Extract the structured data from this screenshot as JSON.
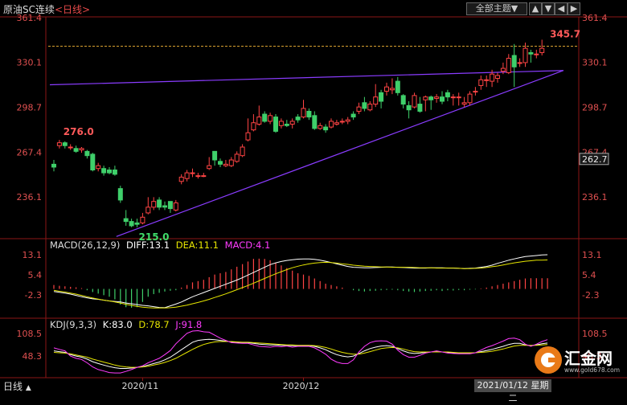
{
  "header": {
    "title": "原油SC连续",
    "period": "<日线>",
    "theme_label": "全部主题▼",
    "theme_arrow": "▼",
    "nav_up": "▲",
    "nav_down": "▼",
    "nav_prev": "◀",
    "nav_next": "▶"
  },
  "footer": {
    "period_label": "日线",
    "period_arrow": "▲",
    "date_readout": "2021/01/12 星期二"
  },
  "macd": {
    "title": "MACD(26,12,9)",
    "diff_label": "DIFF:13.1",
    "dea_label": "DEA:11.1",
    "macd_label": "MACD:4.1",
    "ticks": [
      13.1,
      5.4,
      -2.3
    ],
    "range": [
      -7.2,
      17.4
    ],
    "colors": {
      "diff": "#ffffff",
      "dea": "#e6e600",
      "macd": "#ff00ff"
    }
  },
  "kdj": {
    "title": "KDJ(9,3,3)",
    "k_label": "K:83.0",
    "d_label": "D:78.7",
    "j_label": "J:91.8",
    "ticks": [
      108.5,
      48.3
    ],
    "range": [
      -15,
      125
    ],
    "colors": {
      "k": "#ffffff",
      "d": "#e6e600",
      "j": "#ff00ff"
    }
  },
  "logo": {
    "text": "汇金网",
    "url": "www.gold678.com"
  },
  "chart_data": {
    "type": "candlestick",
    "title": "原油SC连续",
    "y_ticks": [
      361.4,
      330.1,
      298.7,
      267.4,
      236.1
    ],
    "ylim": [
      207,
      362
    ],
    "x_tick_labels": [
      {
        "label": "2020/11",
        "index": 16
      },
      {
        "label": "2020/12",
        "index": 45
      }
    ],
    "last_price": 262.7,
    "high_annotation": {
      "label": "345.7",
      "index": 89
    },
    "prior_high_annotation": {
      "label": "276.0",
      "index": 2
    },
    "low_annotation": {
      "label": "215.0",
      "index": 15
    },
    "dashed_reference": 341.5,
    "trendlines": [
      {
        "from": {
          "index": 0,
          "value": 314.5
        },
        "to": {
          "index": 91,
          "value": 324.5
        }
      },
      {
        "from": {
          "index": 12,
          "value": 208.5
        },
        "to": {
          "index": 91,
          "value": 324.5
        }
      }
    ],
    "candles": [
      [
        259,
        257,
        262,
        254
      ],
      [
        272,
        274,
        276,
        270
      ],
      [
        274,
        272,
        275,
        270
      ],
      [
        271,
        271,
        273,
        269
      ],
      [
        270,
        268,
        272,
        267
      ],
      [
        269,
        270,
        271,
        267
      ],
      [
        268,
        265,
        269,
        263
      ],
      [
        266,
        255,
        267,
        254
      ],
      [
        256,
        258,
        260,
        254
      ],
      [
        256,
        253,
        258,
        251
      ],
      [
        255,
        253,
        257,
        252
      ],
      [
        255,
        252,
        258,
        251
      ],
      [
        242,
        234,
        244,
        232
      ],
      [
        221,
        219,
        227,
        216
      ],
      [
        219,
        216,
        221,
        215
      ],
      [
        218,
        217,
        221,
        215
      ],
      [
        218,
        222,
        225,
        217
      ],
      [
        225,
        229,
        236,
        224
      ],
      [
        229,
        233,
        236,
        227
      ],
      [
        234,
        229,
        236,
        227
      ],
      [
        230,
        229,
        233,
        227
      ],
      [
        233,
        228,
        233,
        225
      ],
      [
        227,
        232,
        234,
        226
      ],
      [
        247,
        250,
        252,
        245
      ],
      [
        249,
        253,
        255,
        247
      ],
      [
        253,
        253,
        256,
        250
      ],
      [
        251,
        251,
        253,
        249
      ],
      [
        251,
        251,
        253,
        250
      ],
      [
        256,
        258,
        264,
        255
      ],
      [
        268,
        262,
        268,
        258
      ],
      [
        261,
        259,
        263,
        257
      ],
      [
        258,
        259,
        262,
        257
      ],
      [
        258,
        262,
        264,
        257
      ],
      [
        261,
        266,
        268,
        260
      ],
      [
        265,
        271,
        273,
        264
      ],
      [
        276,
        281,
        291,
        275
      ],
      [
        283,
        288,
        294,
        282
      ],
      [
        287,
        292,
        300,
        286
      ],
      [
        294,
        289,
        296,
        288
      ],
      [
        289,
        293,
        295,
        287
      ],
      [
        292,
        282,
        294,
        281
      ],
      [
        286,
        289,
        291,
        284
      ],
      [
        287,
        286,
        290,
        285
      ],
      [
        287,
        289,
        291,
        284
      ],
      [
        292,
        290,
        294,
        288
      ],
      [
        292,
        298,
        304,
        291
      ],
      [
        296,
        292,
        298,
        290
      ],
      [
        293,
        284,
        296,
        283
      ],
      [
        284,
        286,
        288,
        283
      ],
      [
        285,
        283,
        287,
        281
      ],
      [
        285,
        289,
        291,
        284
      ],
      [
        287,
        288,
        290,
        286
      ],
      [
        289,
        289,
        291,
        287
      ],
      [
        289,
        290,
        292,
        287
      ],
      [
        294,
        292,
        296,
        290
      ],
      [
        296,
        299,
        302,
        294
      ],
      [
        302,
        298,
        306,
        296
      ],
      [
        297,
        301,
        303,
        296
      ],
      [
        301,
        306,
        315,
        299
      ],
      [
        309,
        303,
        311,
        298
      ],
      [
        310,
        313,
        316,
        307
      ],
      [
        311,
        312,
        319,
        308
      ],
      [
        317,
        309,
        320,
        307
      ],
      [
        307,
        301,
        308,
        298
      ],
      [
        300,
        297,
        303,
        291
      ],
      [
        299,
        307,
        309,
        298
      ],
      [
        301,
        296,
        306,
        295
      ],
      [
        304,
        306,
        307,
        296
      ],
      [
        306,
        304,
        307,
        297
      ],
      [
        305,
        306,
        308,
        302
      ],
      [
        306,
        303,
        310,
        301
      ],
      [
        309,
        306,
        311,
        303
      ],
      [
        306,
        306,
        308,
        300
      ],
      [
        306,
        306,
        309,
        300
      ],
      [
        301,
        302,
        306,
        299
      ],
      [
        302,
        308,
        310,
        300
      ],
      [
        310,
        310,
        313,
        307
      ],
      [
        314,
        318,
        321,
        311
      ],
      [
        318,
        318,
        321,
        313
      ],
      [
        317,
        322,
        325,
        313
      ],
      [
        319,
        321,
        323,
        316
      ],
      [
        324,
        326,
        330,
        322
      ],
      [
        323,
        333,
        336,
        322
      ],
      [
        335,
        327,
        343,
        313
      ],
      [
        330,
        330,
        333,
        327
      ],
      [
        330,
        340,
        344,
        327
      ],
      [
        337,
        336,
        339,
        330
      ],
      [
        336,
        336,
        339,
        333
      ],
      [
        337,
        340,
        346,
        335
      ]
    ],
    "macd_values": [
      1.5,
      1.2,
      1.0,
      0.8,
      0.6,
      0.3,
      -0.5,
      -1.2,
      -1.8,
      -2.4,
      -3.0,
      -4.0,
      -6.0,
      -7.0,
      -7.2,
      -7.0,
      -5.0,
      -3.0,
      -2.0,
      -1.5,
      -1.0,
      -0.7,
      -0.5,
      0.5,
      1.5,
      2.5,
      3.0,
      3.5,
      4.5,
      5.5,
      6.0,
      6.5,
      7.5,
      8.5,
      9.5,
      10.5,
      11.5,
      11.6,
      11.5,
      11.0,
      10.0,
      9.0,
      8.0,
      7.0,
      6.0,
      5.5,
      5.0,
      4.0,
      3.0,
      2.0,
      1.5,
      1.0,
      0.5,
      0.0,
      -0.5,
      -0.8,
      -1.0,
      -0.8,
      -0.7,
      -0.5,
      -0.4,
      -0.3,
      -0.5,
      -0.8,
      -1.0,
      -1.2,
      -1.0,
      -0.8,
      -0.7,
      -0.5,
      -0.8,
      -0.5,
      -0.6,
      -0.4,
      -0.5,
      -0.3,
      -0.2,
      0.2,
      0.5,
      1.0,
      1.5,
      2.0,
      2.5,
      3.0,
      3.5,
      4.0,
      4.1,
      4.1,
      4.1,
      4.1
    ],
    "diff_values": [
      -1.0,
      -1.3,
      -1.6,
      -2.0,
      -2.5,
      -3.0,
      -3.4,
      -3.8,
      -4.0,
      -4.3,
      -4.6,
      -4.8,
      -5.0,
      -5.4,
      -5.7,
      -6.0,
      -6.3,
      -6.5,
      -6.8,
      -7.1,
      -7.2,
      -6.5,
      -5.8,
      -5.0,
      -4.0,
      -3.0,
      -2.2,
      -1.4,
      -0.6,
      0.2,
      1.0,
      1.8,
      2.6,
      3.4,
      4.3,
      5.3,
      6.3,
      7.3,
      8.3,
      9.3,
      10.0,
      10.5,
      10.9,
      11.2,
      11.4,
      11.5,
      11.5,
      11.3,
      11.0,
      10.6,
      10.1,
      9.6,
      9.1,
      8.6,
      8.3,
      8.2,
      8.1,
      8.1,
      8.2,
      8.3,
      8.4,
      8.4,
      8.3,
      8.2,
      8.1,
      8.0,
      8.0,
      8.0,
      8.1,
      8.1,
      8.1,
      8.0,
      8.0,
      7.9,
      7.8,
      7.9,
      8.0,
      8.3,
      8.6,
      9.1,
      9.8,
      10.4,
      11.0,
      11.5,
      12.0,
      12.4,
      12.6,
      12.8,
      13.0,
      13.1
    ],
    "dea_values": [
      -0.5,
      -0.9,
      -1.2,
      -1.6,
      -2.0,
      -2.5,
      -3.0,
      -3.5,
      -3.9,
      -4.3,
      -4.6,
      -5.0,
      -5.4,
      -5.9,
      -6.3,
      -6.7,
      -7.0,
      -7.2,
      -7.3,
      -7.3,
      -7.3,
      -7.2,
      -7.0,
      -6.6,
      -6.2,
      -5.7,
      -5.2,
      -4.6,
      -4.0,
      -3.3,
      -2.6,
      -1.9,
      -1.1,
      -0.3,
      0.5,
      1.3,
      2.2,
      3.1,
      4.0,
      4.9,
      5.8,
      6.6,
      7.4,
      8.1,
      8.7,
      9.2,
      9.6,
      9.9,
      10.1,
      10.2,
      10.1,
      9.9,
      9.6,
      9.4,
      9.1,
      8.9,
      8.7,
      8.6,
      8.5,
      8.4,
      8.4,
      8.3,
      8.3,
      8.3,
      8.3,
      8.2,
      8.1,
      8.1,
      8.1,
      8.0,
      8.0,
      8.0,
      8.0,
      7.9,
      7.8,
      7.8,
      7.9,
      8.0,
      8.2,
      8.5,
      8.8,
      9.2,
      9.6,
      10.0,
      10.3,
      10.6,
      10.8,
      11.0,
      11.0,
      11.1
    ],
    "k_values": [
      62,
      60,
      58,
      52,
      48,
      45,
      40,
      33,
      28,
      24,
      20,
      17,
      15,
      15,
      16,
      18,
      20,
      24,
      28,
      32,
      38,
      45,
      55,
      65,
      75,
      85,
      90,
      92,
      93,
      92,
      90,
      88,
      86,
      85,
      84,
      84,
      82,
      80,
      79,
      78,
      78,
      77,
      77,
      76,
      76,
      76,
      76,
      74,
      70,
      65,
      58,
      52,
      48,
      46,
      48,
      55,
      62,
      68,
      72,
      75,
      76,
      74,
      68,
      62,
      57,
      55,
      56,
      58,
      59,
      60,
      59,
      58,
      57,
      56,
      56,
      56,
      57,
      60,
      63,
      66,
      70,
      74,
      79,
      82,
      82,
      78,
      76,
      78,
      81,
      83
    ],
    "d_values": [
      58,
      57,
      56,
      54,
      51,
      48,
      45,
      40,
      36,
      32,
      28,
      24,
      21,
      19,
      18,
      18,
      19,
      21,
      24,
      27,
      31,
      36,
      42,
      50,
      58,
      66,
      73,
      79,
      83,
      86,
      87,
      87,
      87,
      86,
      85,
      85,
      84,
      83,
      82,
      81,
      80,
      79,
      78,
      78,
      77,
      77,
      77,
      76,
      74,
      71,
      67,
      62,
      58,
      55,
      53,
      53,
      56,
      60,
      64,
      68,
      70,
      71,
      70,
      67,
      63,
      60,
      59,
      59,
      59,
      59,
      59,
      59,
      58,
      57,
      57,
      57,
      57,
      58,
      59,
      61,
      64,
      67,
      71,
      75,
      77,
      77,
      77,
      77,
      78,
      79
    ],
    "j_values": [
      70,
      66,
      62,
      48,
      42,
      39,
      30,
      19,
      12,
      8,
      4,
      3,
      3,
      7,
      12,
      18,
      22,
      30,
      36,
      42,
      52,
      63,
      81,
      95,
      109,
      115,
      116,
      113,
      112,
      104,
      96,
      90,
      84,
      83,
      82,
      82,
      78,
      74,
      73,
      72,
      74,
      73,
      75,
      72,
      74,
      74,
      74,
      70,
      62,
      53,
      40,
      32,
      28,
      28,
      38,
      59,
      74,
      84,
      88,
      89,
      88,
      80,
      64,
      52,
      45,
      45,
      50,
      56,
      59,
      62,
      59,
      56,
      55,
      54,
      54,
      54,
      57,
      64,
      71,
      76,
      82,
      88,
      95,
      96,
      92,
      80,
      74,
      80,
      87,
      92
    ]
  }
}
